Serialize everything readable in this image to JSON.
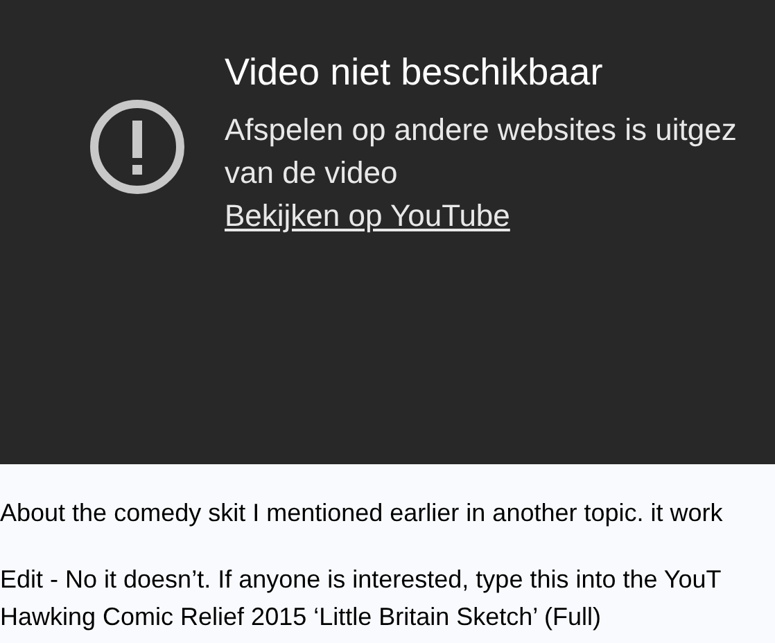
{
  "player": {
    "title": "Video niet beschikbaar",
    "message_lines": [
      "Afspelen op andere websites is uitgez",
      "van de video"
    ],
    "link": "Bekijken op YouTube"
  },
  "post": {
    "paragraphs": [
      [
        "About the comedy skit I mentioned earlier in another topic. it work"
      ],
      [
        "Edit - No it doesn’t. If anyone is interested, type this into the YouT",
        "Hawking Comic Relief 2015 ‘Little Britain Sketch’ (Full)"
      ]
    ]
  }
}
